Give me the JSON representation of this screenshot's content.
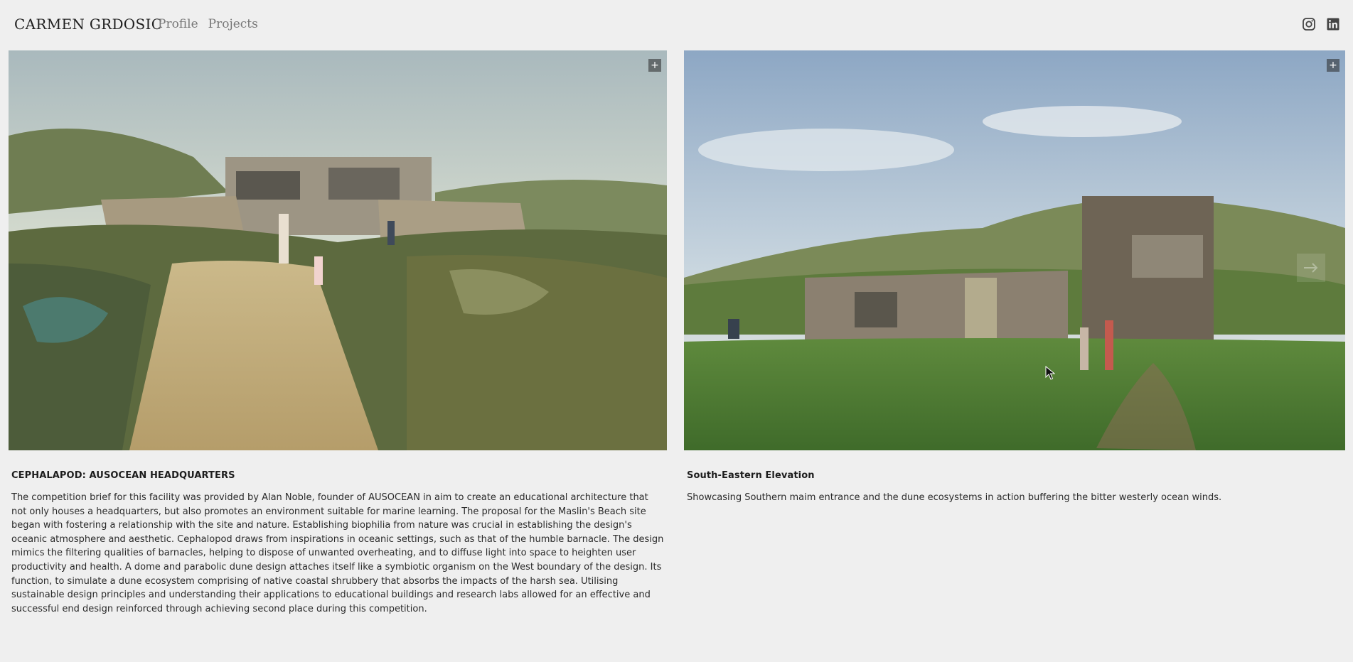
{
  "header": {
    "logo": "CARMEN GRDOSIC",
    "nav": [
      {
        "label": "Profile"
      },
      {
        "label": "Projects"
      }
    ],
    "social": [
      {
        "icon": "instagram-icon"
      },
      {
        "icon": "linkedin-icon"
      }
    ]
  },
  "gallery": {
    "left": {
      "expand_icon": "+",
      "title": "CEPHALAPOD: AUSOCEAN HEADQUARTERS",
      "description": "The competition brief for this facility was provided by Alan Noble, founder of AUSOCEAN in aim to create an educational architecture that not only houses a headquarters, but also promotes an environment suitable for marine learning. The proposal for the Maslin's Beach site began with fostering a relationship with the site and nature. Establishing biophilia from nature was crucial in establishing the design's oceanic atmosphere and aesthetic. Cephalopod draws from inspirations in oceanic settings, such as that of the humble barnacle. The design mimics the filtering qualities of barnacles, helping to dispose of unwanted overheating, and to diffuse light into space to heighten user productivity and health. A dome and parabolic dune design attaches itself like a symbiotic organism on the West boundary of the design. Its function, to simulate a dune ecosystem comprising of native coastal shrubbery that absorbs the impacts of the harsh sea. Utilising sustainable design principles and understanding their applications to educational buildings and research labs allowed for an effective and successful end design reinforced through achieving second place during this competition."
    },
    "right": {
      "expand_icon": "+",
      "title": "South-Eastern Elevation",
      "description": "Showcasing Southern maim entrance and the dune ecosystems in action buffering the bitter westerly ocean winds."
    }
  }
}
